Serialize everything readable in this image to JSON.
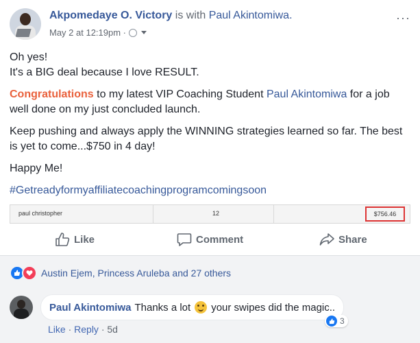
{
  "post": {
    "author": "Akpomedaye O. Victory",
    "with_text": "is with",
    "tagged": "Paul Akintomiwa.",
    "timestamp": "May 2 at 12:19pm ·",
    "more": "···",
    "lines": {
      "l1": "Oh yes!",
      "l2": "It's a BIG deal because I love RESULT.",
      "congrats": "Congratulations",
      "p2a": " to my latest VIP Coaching Student ",
      "p2name": "Paul Akintomiwa",
      "p2b": " for a job well done on my just concluded launch.",
      "p3": "Keep pushing and always apply the WINNING strategies learned so far. The best is yet to come...$750 in 4 day!",
      "p4": "Happy Me!",
      "hashtag": "#Getreadyformyaffiliatecoachingprogramcomingsoon"
    },
    "screenshot_row": {
      "name": "paul christopher",
      "count": "12",
      "amount": "$756.46"
    }
  },
  "actions": {
    "like": "Like",
    "comment": "Comment",
    "share": "Share"
  },
  "reactions": {
    "summary": "Austin Ejem, Princess Aruleba and 27 others"
  },
  "comment": {
    "name": "Paul Akintomiwa",
    "text_a": "Thanks a lot",
    "text_b": "your swipes did the magic..",
    "likes": "3",
    "like_link": "Like",
    "reply_link": "Reply",
    "age": "· 5d",
    "dot": "·"
  },
  "colors": {
    "link": "#365899",
    "accent": "#e9603b",
    "fb_blue": "#1877f2"
  }
}
